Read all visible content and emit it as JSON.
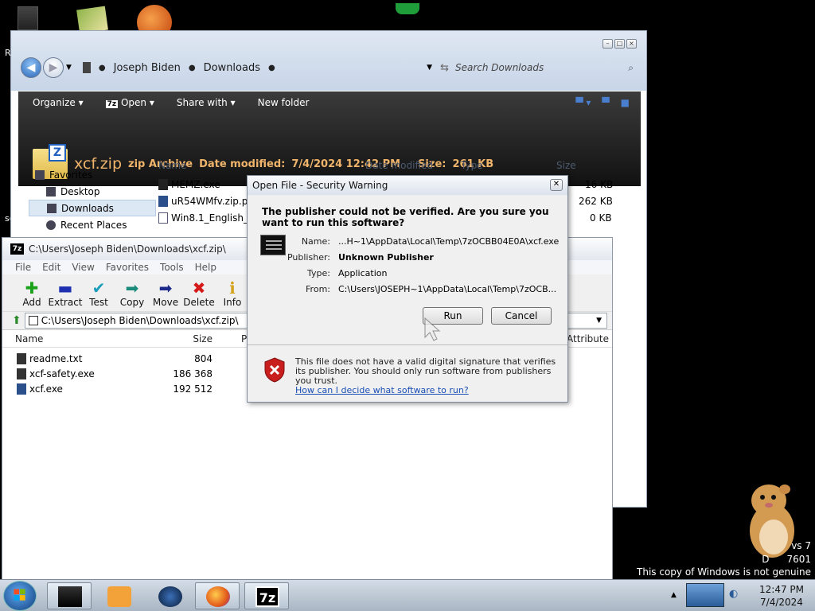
{
  "explorer": {
    "breadcrumb": [
      "Joseph Biden",
      "Downloads"
    ],
    "search_placeholder": "Search Downloads",
    "commands": {
      "organize": "Organize",
      "open": "Open",
      "share_with": "Share with",
      "new_folder": "New folder"
    },
    "details": {
      "filename": "xcf.zip",
      "type": "zip Archive",
      "date_label": "Date modified:",
      "date_value": "7/4/2024 12:42 PM",
      "size_label": "Size:",
      "size_value": "261 KB"
    },
    "nav": {
      "favorites": "Favorites",
      "desktop": "Desktop",
      "downloads": "Downloads",
      "recent_places": "Recent Places"
    },
    "columns": {
      "name": "Name",
      "date_modified": "Date modified",
      "type": "Type",
      "size": "Size"
    },
    "files": [
      {
        "name": "MEMZ.exe",
        "size": "16 KB"
      },
      {
        "name": "uR54WMfv.zip.pa",
        "size": "262 KB"
      },
      {
        "name": "Win8.1_English_x",
        "size": "0 KB"
      }
    ]
  },
  "sevenzip": {
    "title": "C:\\Users\\Joseph Biden\\Downloads\\xcf.zip\\",
    "menu": [
      "File",
      "Edit",
      "View",
      "Favorites",
      "Tools",
      "Help"
    ],
    "toolbar": [
      "Add",
      "Extract",
      "Test",
      "Copy",
      "Move",
      "Delete",
      "Info"
    ],
    "path": "C:\\Users\\Joseph Biden\\Downloads\\xcf.zip\\",
    "columns": {
      "name": "Name",
      "size": "Size",
      "packed": "P",
      "attributes": "Attribute"
    },
    "files": [
      {
        "name": "readme.txt",
        "size": "804"
      },
      {
        "name": "xcf-safety.exe",
        "size": "186 368"
      },
      {
        "name": "xcf.exe",
        "size": "192 512"
      }
    ]
  },
  "dialog": {
    "title": "Open File - Security Warning",
    "question": "The publisher could not be verified.  Are you sure you want to run this software?",
    "fields": [
      {
        "label": "Name:",
        "value": "...H~1\\AppData\\Local\\Temp\\7zOCBB04E0A\\xcf.exe",
        "bold": false
      },
      {
        "label": "Publisher:",
        "value": "Unknown Publisher",
        "bold": true
      },
      {
        "label": "Type:",
        "value": "Application",
        "bold": false
      },
      {
        "label": "From:",
        "value": "C:\\Users\\JOSEPH~1\\AppData\\Local\\Temp\\7zOCB...",
        "bold": false
      }
    ],
    "run_label": "Run",
    "cancel_label": "Cancel",
    "warning_text": "This file does not have a valid digital signature that verifies its publisher.  You should only run software from publishers you trust.",
    "help_link": "How can I decide what software to run?"
  },
  "desktop": {
    "left_edge_texts": [
      "R",
      "sc"
    ],
    "watermark_line1": "vs 7",
    "watermark_line2": "7601",
    "watermark_prefix": "D",
    "genuine_notice": "This copy of Windows is not genuine"
  },
  "taskbar": {
    "time": "12:47 PM",
    "date": "7/4/2024",
    "apps": [
      "app-blackbox",
      "media-player",
      "globe",
      "firefox",
      "7zip"
    ]
  },
  "colors": {
    "accent_orange": "#f0b46b",
    "link_blue": "#1a4fb5"
  }
}
